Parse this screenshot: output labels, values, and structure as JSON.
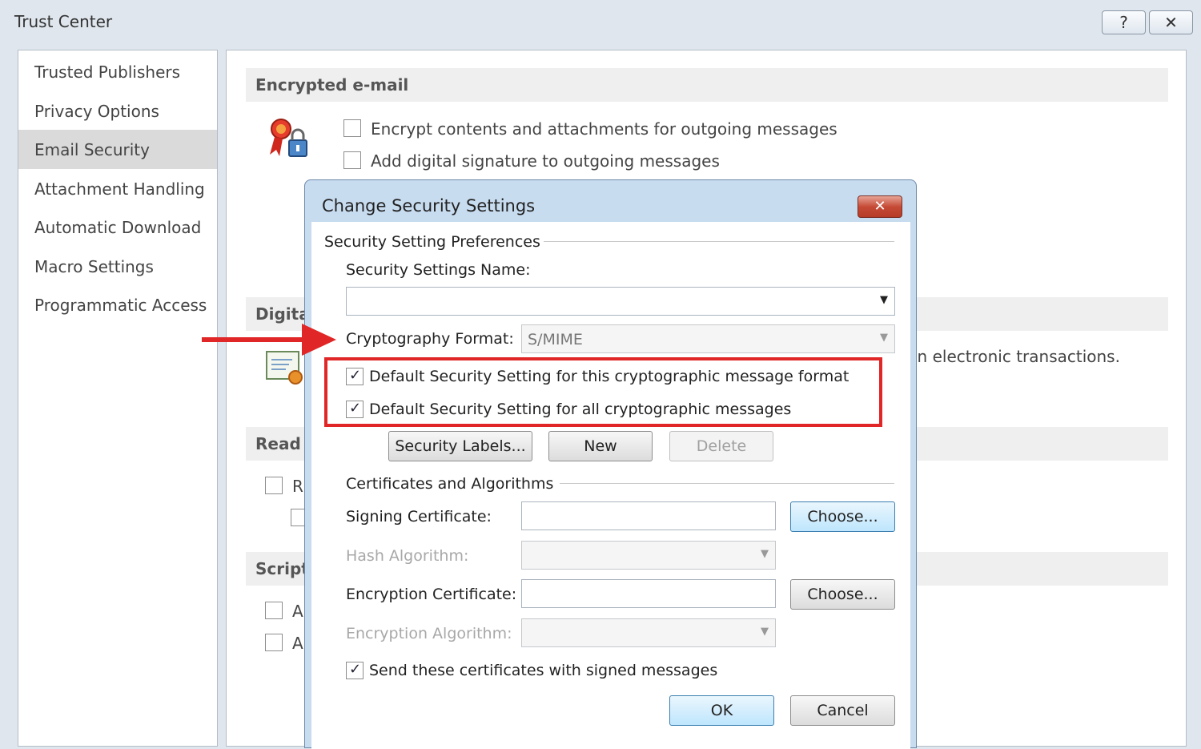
{
  "window": {
    "title": "Trust Center",
    "help_label": "?",
    "close_label": "✕"
  },
  "sidebar": {
    "items": [
      {
        "label": "Trusted Publishers"
      },
      {
        "label": "Privacy Options"
      },
      {
        "label": "Email Security"
      },
      {
        "label": "Attachment Handling"
      },
      {
        "label": "Automatic Download"
      },
      {
        "label": "Macro Settings"
      },
      {
        "label": "Programmatic Access"
      }
    ],
    "active": "Email Security"
  },
  "main": {
    "encrypted_email": {
      "heading": "Encrypted e-mail",
      "encrypt_label": "Encrypt contents and attachments for outgoing messages",
      "encrypt_checked": false,
      "signature_label": "Add digital signature to outgoing messages",
      "signature_checked": false
    },
    "digital_ids": {
      "heading_visible": "Digita",
      "text_visible": "in electronic transactions."
    },
    "read_as_plain": {
      "heading_visible": "Read a",
      "option_visible": "R"
    },
    "script": {
      "heading_visible": "Script",
      "option1_visible": "A",
      "option2_visible": "A"
    }
  },
  "dialog": {
    "title": "Change Security Settings",
    "close_label": "✕",
    "preferences_group": "Security Setting Preferences",
    "name_label": "Security Settings Name:",
    "name_value": "",
    "format_label": "Cryptography Format:",
    "format_value": "S/MIME",
    "default_format": {
      "label": "Default Security Setting for this cryptographic message format",
      "checked": true
    },
    "default_all": {
      "label": "Default Security Setting for all cryptographic messages",
      "checked": true
    },
    "buttons": {
      "security_labels": "Security Labels...",
      "new": "New",
      "delete": "Delete",
      "choose_signing": "Choose...",
      "choose_encryption": "Choose...",
      "ok": "OK",
      "cancel": "Cancel"
    },
    "certs_group": "Certificates and Algorithms",
    "signing_cert_label": "Signing Certificate:",
    "signing_cert_value": "",
    "hash_label": "Hash Algorithm:",
    "encryption_cert_label": "Encryption Certificate:",
    "encryption_cert_value": "",
    "encryption_alg_label": "Encryption Algorithm:",
    "send_certs": {
      "label": "Send these certificates with signed messages",
      "checked": true
    }
  },
  "annotations": {
    "arrow_color": "#e02626",
    "highlight_color": "#e02626"
  }
}
